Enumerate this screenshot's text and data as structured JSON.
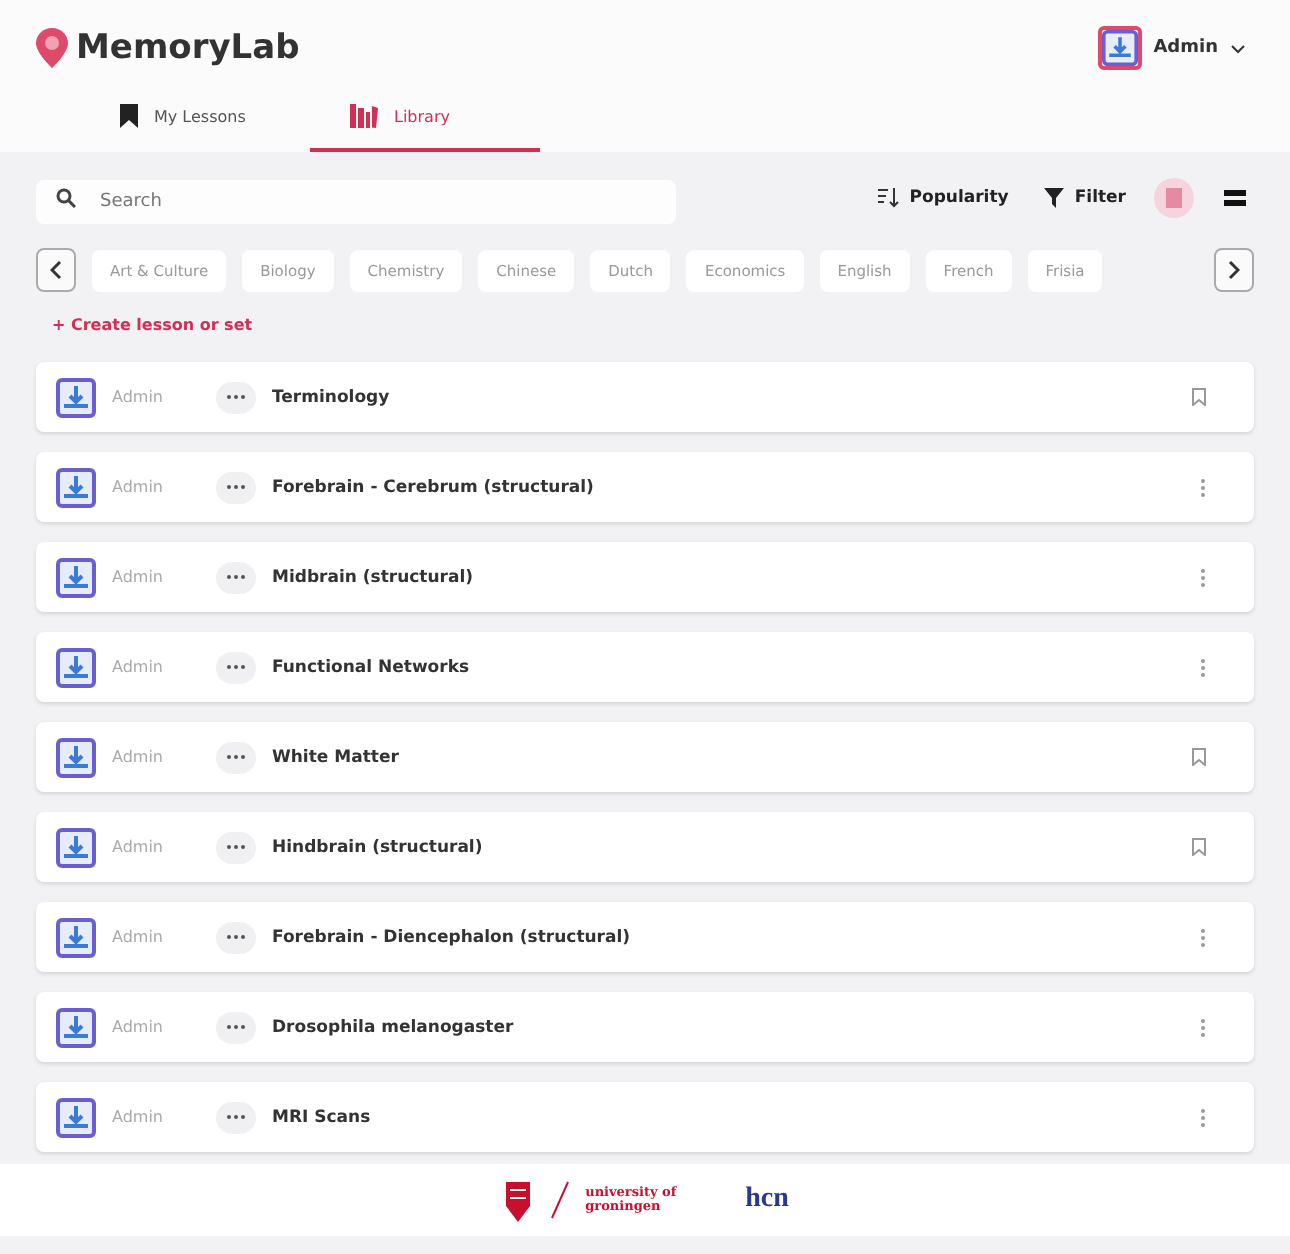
{
  "app": {
    "name": "MemoryLab"
  },
  "user": {
    "name": "Admin"
  },
  "tabs": [
    {
      "label": "My Lessons",
      "kind": "bookmark",
      "selected": false
    },
    {
      "label": "Library",
      "kind": "books",
      "selected": true
    }
  ],
  "search": {
    "placeholder": "Search"
  },
  "toolbar": {
    "sort": "Popularity",
    "filter": "Filter",
    "views": [
      {
        "kind": "grid",
        "selected": true
      },
      {
        "kind": "list",
        "selected": false
      }
    ]
  },
  "categories": [
    "Art & Culture",
    "Biology",
    "Chemistry",
    "Chinese",
    "Dutch",
    "Economics",
    "English",
    "French",
    "Frisia"
  ],
  "create_link": "+ Create lesson or set",
  "lessons": [
    {
      "author": "Admin",
      "title": "Terminology",
      "kind": "bookmark"
    },
    {
      "author": "Admin",
      "title": "Forebrain - Cerebrum (structural)",
      "kind": "more"
    },
    {
      "author": "Admin",
      "title": "Midbrain (structural)",
      "kind": "more"
    },
    {
      "author": "Admin",
      "title": "Functional Networks",
      "kind": "more"
    },
    {
      "author": "Admin",
      "title": "White Matter",
      "kind": "bookmark"
    },
    {
      "author": "Admin",
      "title": "Hindbrain (structural)",
      "kind": "bookmark"
    },
    {
      "author": "Admin",
      "title": "Forebrain - Diencephalon (structural)",
      "kind": "more"
    },
    {
      "author": "Admin",
      "title": "Drosophila melanogaster",
      "kind": "more"
    },
    {
      "author": "Admin",
      "title": "MRI Scans",
      "kind": "more"
    }
  ],
  "footer": {
    "university": "university of groningen",
    "partner": "hcn"
  }
}
